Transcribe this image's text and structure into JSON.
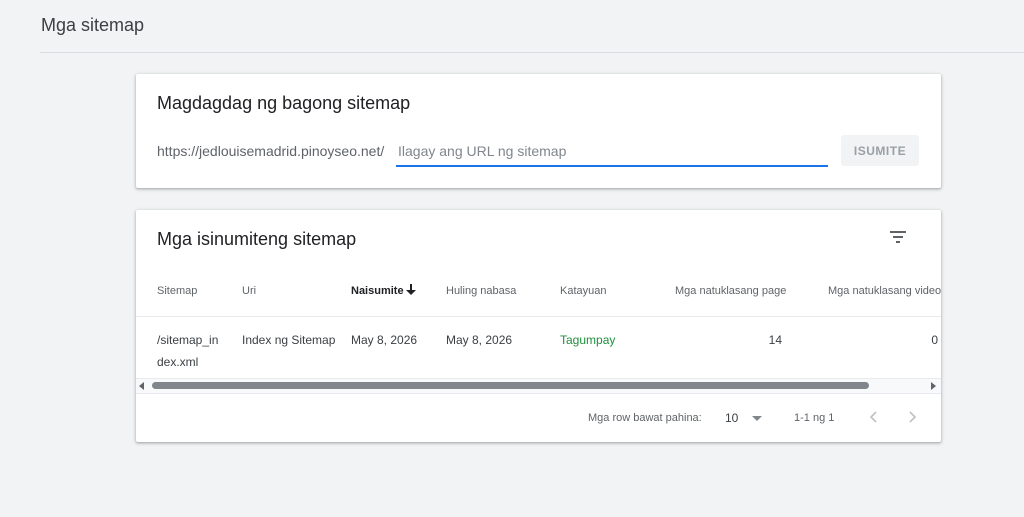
{
  "page": {
    "title": "Mga sitemap"
  },
  "add_sitemap": {
    "title": "Magdagdag ng bagong sitemap",
    "url_prefix": "https://jedlouisemadrid.pinoyseo.net/",
    "input_value": "",
    "input_placeholder": "Ilagay ang URL ng sitemap",
    "submit_label": "ISUMITE"
  },
  "submitted": {
    "title": "Mga isinumiteng sitemap",
    "filter_icon": "filter-list-icon",
    "columns": {
      "sitemap": "Sitemap",
      "type": "Uri",
      "submitted": "Naisumite",
      "last_read": "Huling nabasa",
      "status": "Katayuan",
      "discovered_pages": "Mga natuklasang page",
      "discovered_videos": "Mga natuklasang video"
    },
    "sort": {
      "column": "submitted",
      "direction": "descending",
      "icon": "arrow-down-icon"
    },
    "rows": [
      {
        "sitemap": "/sitemap_index.xml",
        "type": "Index ng Sitemap",
        "submitted": "May 8, 2026",
        "last_read": "May 8, 2026",
        "status": "Tagumpay",
        "discovered_pages": "14",
        "discovered_videos": "0"
      }
    ],
    "pagination": {
      "rows_per_page_label": "Mga row bawat pahina:",
      "rows_per_page": "10",
      "range": "1-1 ng 1",
      "prev_icon": "chevron-left-icon",
      "next_icon": "chevron-right-icon"
    }
  },
  "colors": {
    "accent": "#1a73e8",
    "success": "#1e8e3e",
    "background": "#f1f3f4"
  }
}
